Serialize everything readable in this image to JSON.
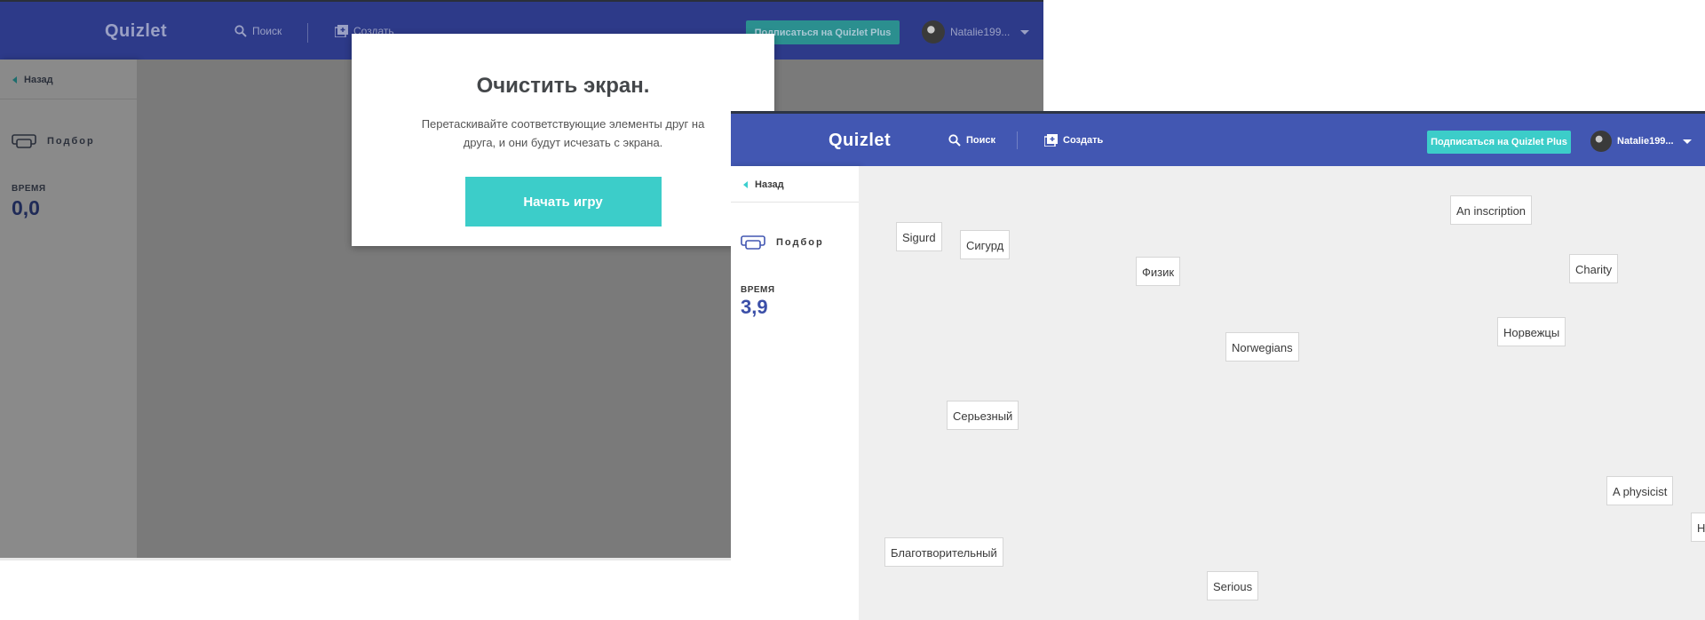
{
  "colors": {
    "back_header": "#2d3a89",
    "front_header": "#4257b2",
    "accent_teal": "#3ccdc9",
    "time_blue": "#3b4fa8"
  },
  "back_window": {
    "logo": "Quizlet",
    "search_label": "Поиск",
    "create_label": "Создать",
    "plus_label": "Подписаться на Quizlet Plus",
    "user_name": "Natalie199...",
    "back_label": "Назад",
    "mode_label": "Подбор",
    "time_label": "ВРЕМЯ",
    "time_value": "0,0",
    "modal": {
      "title": "Очистить экран.",
      "description": "Перетаскивайте соответствующие элементы друг на друга, и они будут исчезать с экрана.",
      "start_button": "Начать игру"
    }
  },
  "front_window": {
    "logo": "Quizlet",
    "search_label": "Поиск",
    "create_label": "Создать",
    "plus_label": "Подписаться на Quizlet Plus",
    "user_name": "Natalie199...",
    "back_label": "Назад",
    "mode_label": "Подбор",
    "time_label": "ВРЕМЯ",
    "time_value": "3,9",
    "tiles": [
      "An inscription",
      "Sigurd",
      "Сигурд",
      "Физик",
      "Charity",
      "Норвежцы",
      "Norwegians",
      "Серьезный",
      "A physicist",
      "Надпись",
      "Благотворительный",
      "Serious"
    ]
  },
  "icons": {
    "search": "search-icon",
    "create": "create-plus-icon",
    "match": "match-cards-icon",
    "back": "back-arrow-icon",
    "dropdown": "chevron-down-icon"
  }
}
